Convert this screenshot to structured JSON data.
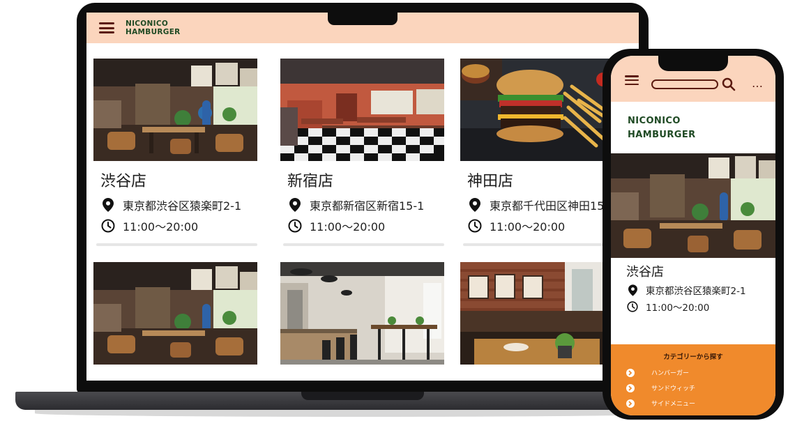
{
  "site": {
    "logo_line1": "NICONICO",
    "logo_line2": "HAMBURGER"
  },
  "colors": {
    "header_bg": "#fbd5bd",
    "accent_dark": "#5b1a10",
    "logo_green": "#1f4a24",
    "category_bg": "#f08a2c"
  },
  "desktop": {
    "stores": [
      {
        "name": "渋谷店",
        "address": "東京都渋谷区猿楽町2-1",
        "hours": "11:00〜20:00"
      },
      {
        "name": "新宿店",
        "address": "東京都新宿区新宿15-1",
        "hours": "11:00〜20:00"
      },
      {
        "name": "神田店",
        "address": "東京都千代田区神田15",
        "hours": "11:00〜20:00"
      }
    ]
  },
  "mobile": {
    "store": {
      "name": "渋谷店",
      "address": "東京都渋谷区猿楽町2-1",
      "hours": "11:00〜20:00"
    },
    "more_label": "…",
    "category": {
      "title": "カテゴリーから探す",
      "items": [
        "ハンバーガー",
        "サンドウィッチ",
        "サイドメニュー"
      ]
    }
  },
  "icons": {
    "menu": "hamburger-menu-icon",
    "location": "location-pin-icon",
    "clock": "clock-icon",
    "search": "search-icon",
    "chevron": "chevron-right-icon"
  }
}
